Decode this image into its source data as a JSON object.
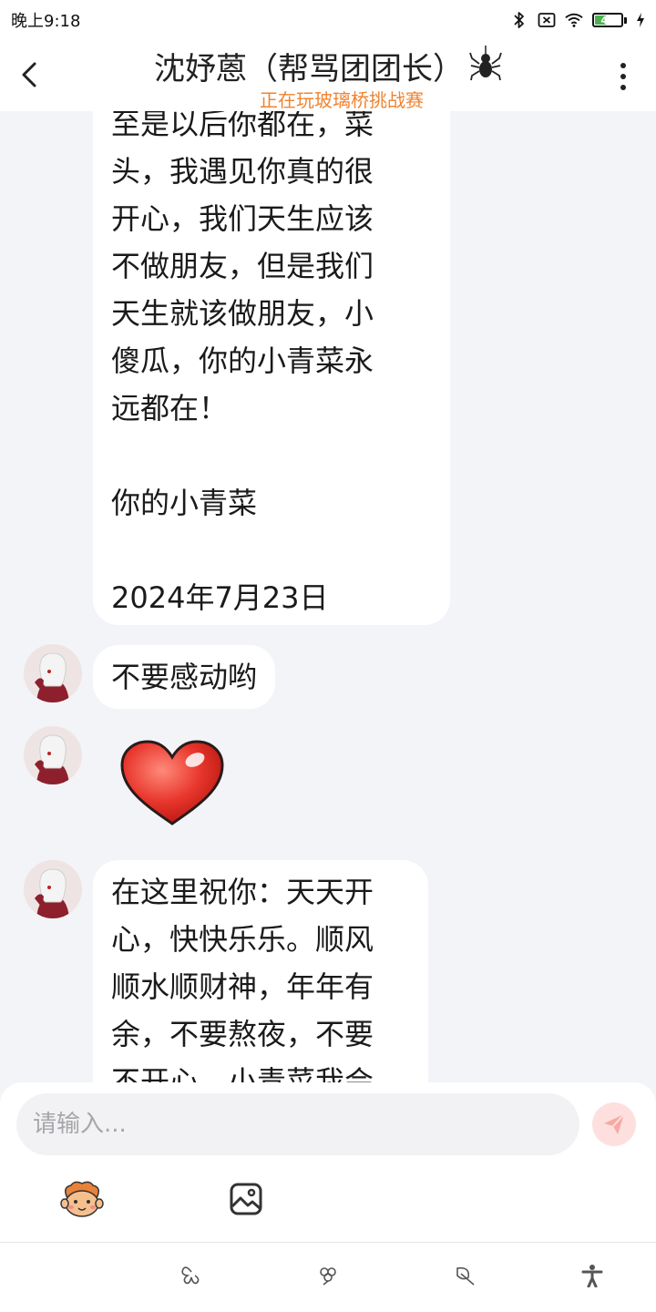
{
  "status_bar": {
    "time": "晚上9:18",
    "battery_level": 46,
    "battery_text": "46",
    "icons": [
      "bluetooth-icon",
      "sim-x-icon",
      "wifi-icon",
      "battery-icon",
      "charging-icon"
    ]
  },
  "header": {
    "title": "沈妤蒽（帮骂团团长）",
    "subtitle": "正在玩玻璃桥挑战赛",
    "title_icon": "spider-icon",
    "back_icon": "back-arrow-icon",
    "more_icon": "more-vertical-icon"
  },
  "messages": [
    {
      "type": "text",
      "lines": [
        "至是以后你都在，菜",
        "头，我遇见你真的很",
        "开心，我们天生应该",
        "不做朋友，但是我们",
        "天生就该做朋友，小",
        "傻瓜，你的小青菜永",
        "远都在！",
        "",
        "你的小青菜",
        "",
        "2024年7月23日"
      ]
    },
    {
      "type": "text",
      "lines": [
        "不要感动哟"
      ]
    },
    {
      "type": "sticker",
      "sticker": "heart-icon"
    },
    {
      "type": "text",
      "lines": [
        "在这里祝你：天天开",
        "心，快快乐乐。顺风",
        "顺水顺财神，年年有",
        "余，不要熬夜，不要",
        "不开心，小青菜我会"
      ]
    }
  ],
  "input": {
    "value": "",
    "placeholder": "请输入..."
  },
  "colors": {
    "accent_orange": "#f0832f",
    "send_bg": "#fde0de",
    "send_icon": "#f7a9a4",
    "background": "#f3f4f8"
  },
  "toolbar": {
    "emoji_icon": "monkey-emoji-icon",
    "image_icon": "image-icon",
    "send_icon": "send-icon"
  },
  "bottom_nav": [
    "butterfly-icon",
    "flower-icon",
    "leaf-icon",
    "accessibility-icon"
  ]
}
